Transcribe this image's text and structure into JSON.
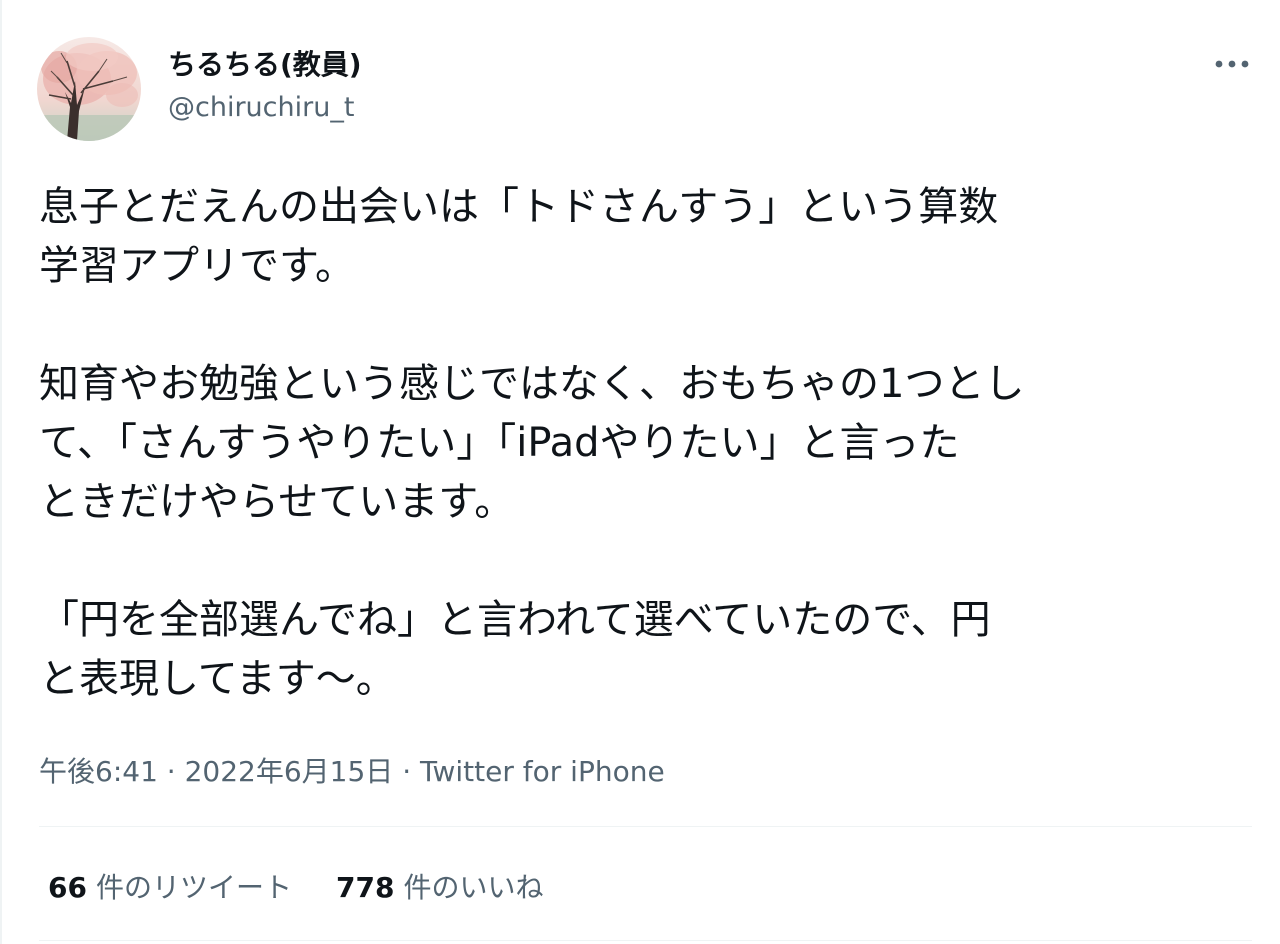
{
  "tweet": {
    "author": {
      "display_name": "ちるちる(教員)",
      "handle": "@chiruchiru_t",
      "avatar": "cherry-blossom-tree-avatar"
    },
    "more_icon": "more-horizontal-icon",
    "text": "息子とだえんの出会いは「トドさんすう」という算数\n学習アプリです。\n\n知育やお勉強という感じではなく、おもちゃの1つとし\nて、「さんすうやりたい」「iPadやりたい」と言った\nときだけやらせています。\n\n「円を全部選んでね」と言われて選べていたので、円\nと表現してます〜。",
    "time": "午後6:41",
    "separator": "·",
    "date": "2022年6月15日",
    "source": "Twitter for iPhone",
    "retweets": {
      "count": "66",
      "label": "件のリツイート"
    },
    "likes": {
      "count": "778",
      "label": "件のいいね"
    }
  },
  "colors": {
    "text": "#0f1419",
    "secondary": "#536471",
    "divider": "#eff3f4"
  }
}
